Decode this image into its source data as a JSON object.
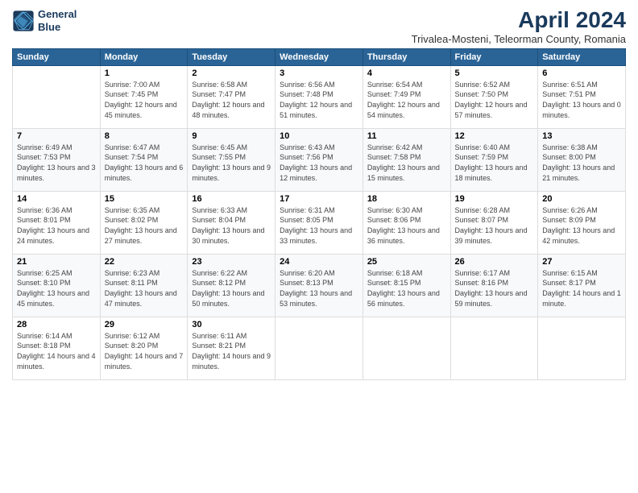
{
  "logo": {
    "line1": "General",
    "line2": "Blue"
  },
  "title": "April 2024",
  "subtitle": "Trivalea-Mosteni, Teleorman County, Romania",
  "days_of_week": [
    "Sunday",
    "Monday",
    "Tuesday",
    "Wednesday",
    "Thursday",
    "Friday",
    "Saturday"
  ],
  "weeks": [
    [
      {
        "num": "",
        "sunrise": "",
        "sunset": "",
        "daylight": ""
      },
      {
        "num": "1",
        "sunrise": "Sunrise: 7:00 AM",
        "sunset": "Sunset: 7:45 PM",
        "daylight": "Daylight: 12 hours and 45 minutes."
      },
      {
        "num": "2",
        "sunrise": "Sunrise: 6:58 AM",
        "sunset": "Sunset: 7:47 PM",
        "daylight": "Daylight: 12 hours and 48 minutes."
      },
      {
        "num": "3",
        "sunrise": "Sunrise: 6:56 AM",
        "sunset": "Sunset: 7:48 PM",
        "daylight": "Daylight: 12 hours and 51 minutes."
      },
      {
        "num": "4",
        "sunrise": "Sunrise: 6:54 AM",
        "sunset": "Sunset: 7:49 PM",
        "daylight": "Daylight: 12 hours and 54 minutes."
      },
      {
        "num": "5",
        "sunrise": "Sunrise: 6:52 AM",
        "sunset": "Sunset: 7:50 PM",
        "daylight": "Daylight: 12 hours and 57 minutes."
      },
      {
        "num": "6",
        "sunrise": "Sunrise: 6:51 AM",
        "sunset": "Sunset: 7:51 PM",
        "daylight": "Daylight: 13 hours and 0 minutes."
      }
    ],
    [
      {
        "num": "7",
        "sunrise": "Sunrise: 6:49 AM",
        "sunset": "Sunset: 7:53 PM",
        "daylight": "Daylight: 13 hours and 3 minutes."
      },
      {
        "num": "8",
        "sunrise": "Sunrise: 6:47 AM",
        "sunset": "Sunset: 7:54 PM",
        "daylight": "Daylight: 13 hours and 6 minutes."
      },
      {
        "num": "9",
        "sunrise": "Sunrise: 6:45 AM",
        "sunset": "Sunset: 7:55 PM",
        "daylight": "Daylight: 13 hours and 9 minutes."
      },
      {
        "num": "10",
        "sunrise": "Sunrise: 6:43 AM",
        "sunset": "Sunset: 7:56 PM",
        "daylight": "Daylight: 13 hours and 12 minutes."
      },
      {
        "num": "11",
        "sunrise": "Sunrise: 6:42 AM",
        "sunset": "Sunset: 7:58 PM",
        "daylight": "Daylight: 13 hours and 15 minutes."
      },
      {
        "num": "12",
        "sunrise": "Sunrise: 6:40 AM",
        "sunset": "Sunset: 7:59 PM",
        "daylight": "Daylight: 13 hours and 18 minutes."
      },
      {
        "num": "13",
        "sunrise": "Sunrise: 6:38 AM",
        "sunset": "Sunset: 8:00 PM",
        "daylight": "Daylight: 13 hours and 21 minutes."
      }
    ],
    [
      {
        "num": "14",
        "sunrise": "Sunrise: 6:36 AM",
        "sunset": "Sunset: 8:01 PM",
        "daylight": "Daylight: 13 hours and 24 minutes."
      },
      {
        "num": "15",
        "sunrise": "Sunrise: 6:35 AM",
        "sunset": "Sunset: 8:02 PM",
        "daylight": "Daylight: 13 hours and 27 minutes."
      },
      {
        "num": "16",
        "sunrise": "Sunrise: 6:33 AM",
        "sunset": "Sunset: 8:04 PM",
        "daylight": "Daylight: 13 hours and 30 minutes."
      },
      {
        "num": "17",
        "sunrise": "Sunrise: 6:31 AM",
        "sunset": "Sunset: 8:05 PM",
        "daylight": "Daylight: 13 hours and 33 minutes."
      },
      {
        "num": "18",
        "sunrise": "Sunrise: 6:30 AM",
        "sunset": "Sunset: 8:06 PM",
        "daylight": "Daylight: 13 hours and 36 minutes."
      },
      {
        "num": "19",
        "sunrise": "Sunrise: 6:28 AM",
        "sunset": "Sunset: 8:07 PM",
        "daylight": "Daylight: 13 hours and 39 minutes."
      },
      {
        "num": "20",
        "sunrise": "Sunrise: 6:26 AM",
        "sunset": "Sunset: 8:09 PM",
        "daylight": "Daylight: 13 hours and 42 minutes."
      }
    ],
    [
      {
        "num": "21",
        "sunrise": "Sunrise: 6:25 AM",
        "sunset": "Sunset: 8:10 PM",
        "daylight": "Daylight: 13 hours and 45 minutes."
      },
      {
        "num": "22",
        "sunrise": "Sunrise: 6:23 AM",
        "sunset": "Sunset: 8:11 PM",
        "daylight": "Daylight: 13 hours and 47 minutes."
      },
      {
        "num": "23",
        "sunrise": "Sunrise: 6:22 AM",
        "sunset": "Sunset: 8:12 PM",
        "daylight": "Daylight: 13 hours and 50 minutes."
      },
      {
        "num": "24",
        "sunrise": "Sunrise: 6:20 AM",
        "sunset": "Sunset: 8:13 PM",
        "daylight": "Daylight: 13 hours and 53 minutes."
      },
      {
        "num": "25",
        "sunrise": "Sunrise: 6:18 AM",
        "sunset": "Sunset: 8:15 PM",
        "daylight": "Daylight: 13 hours and 56 minutes."
      },
      {
        "num": "26",
        "sunrise": "Sunrise: 6:17 AM",
        "sunset": "Sunset: 8:16 PM",
        "daylight": "Daylight: 13 hours and 59 minutes."
      },
      {
        "num": "27",
        "sunrise": "Sunrise: 6:15 AM",
        "sunset": "Sunset: 8:17 PM",
        "daylight": "Daylight: 14 hours and 1 minute."
      }
    ],
    [
      {
        "num": "28",
        "sunrise": "Sunrise: 6:14 AM",
        "sunset": "Sunset: 8:18 PM",
        "daylight": "Daylight: 14 hours and 4 minutes."
      },
      {
        "num": "29",
        "sunrise": "Sunrise: 6:12 AM",
        "sunset": "Sunset: 8:20 PM",
        "daylight": "Daylight: 14 hours and 7 minutes."
      },
      {
        "num": "30",
        "sunrise": "Sunrise: 6:11 AM",
        "sunset": "Sunset: 8:21 PM",
        "daylight": "Daylight: 14 hours and 9 minutes."
      },
      {
        "num": "",
        "sunrise": "",
        "sunset": "",
        "daylight": ""
      },
      {
        "num": "",
        "sunrise": "",
        "sunset": "",
        "daylight": ""
      },
      {
        "num": "",
        "sunrise": "",
        "sunset": "",
        "daylight": ""
      },
      {
        "num": "",
        "sunrise": "",
        "sunset": "",
        "daylight": ""
      }
    ]
  ]
}
